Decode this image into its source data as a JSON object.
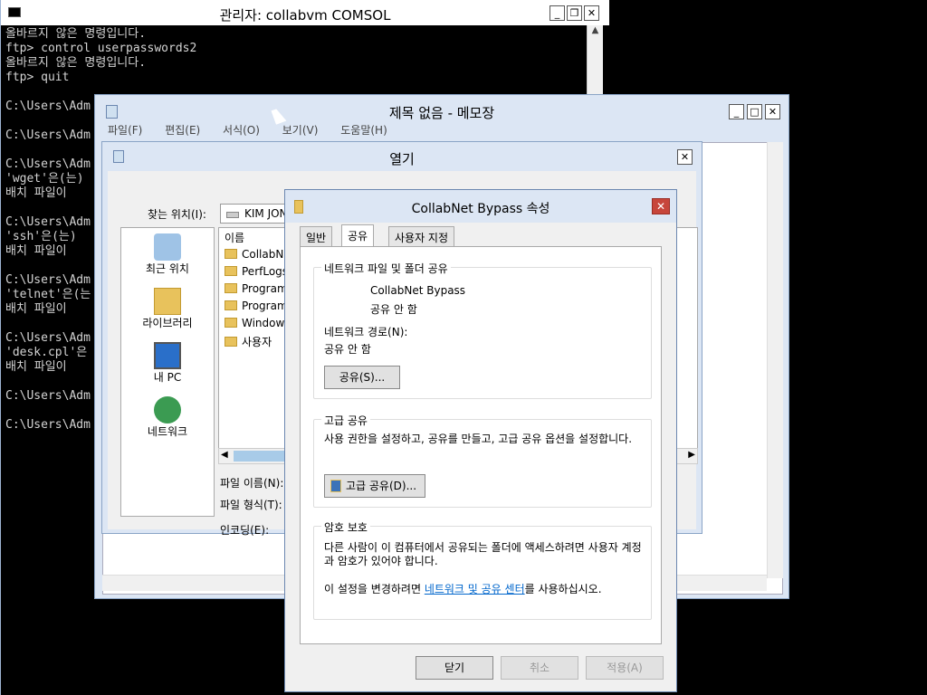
{
  "console": {
    "title": "관리자:  collabvm COMSOL",
    "lines": [
      "올바르지 않은 명령입니다.",
      "ftp> control userpasswords2",
      "올바르지 않은 명령입니다.",
      "ftp> quit",
      "",
      "C:\\Users\\Adm",
      "",
      "C:\\Users\\Adm",
      "",
      "C:\\Users\\Adm",
      "'wget'은(는)",
      "배치 파일이",
      "",
      "C:\\Users\\Adm",
      "'ssh'은(는)",
      "배치 파일이",
      "",
      "C:\\Users\\Adm",
      "'telnet'은(는",
      "배치 파일이",
      "",
      "C:\\Users\\Adm",
      "'desk.cpl'은",
      "배치 파일이",
      "",
      "C:\\Users\\Adm",
      "",
      "C:\\Users\\Adm"
    ]
  },
  "notepad": {
    "title": "제목 없음 - 메모장",
    "menu": [
      "파일(F)",
      "편집(E)",
      "서식(O)",
      "보기(V)",
      "도움말(H)"
    ]
  },
  "open_dialog": {
    "title": "열기",
    "look_in_label": "찾는 위치(I):",
    "look_in_value": "KIM JONG UN (C:)",
    "places": [
      "최근 위치",
      "라이브러리",
      "내 PC",
      "네트워크"
    ],
    "column_name": "이름",
    "files": [
      "CollabNet",
      "PerfLogs",
      "Program F",
      "Program F",
      "Windows",
      "사용자"
    ],
    "filename_label": "파일 이름(N):",
    "filetype_label": "파일 형식(T):",
    "encoding_label": "인코딩(E):"
  },
  "props": {
    "title": "CollabNet Bypass 속성",
    "close": "✕",
    "tabs": [
      "일반",
      "공유",
      "사용자 지정"
    ],
    "net_share_group": "네트워크 파일 및 폴더 공유",
    "share_name": "CollabNet Bypass",
    "share_state": "공유 안 함",
    "net_path_label": "네트워크 경로(N):",
    "net_path_value": "공유 안 함",
    "share_button": "공유(S)...",
    "adv_group": "고급 공유",
    "adv_text": "사용 권한을 설정하고, 공유를 만들고, 고급 공유 옵션을 설정합니다.",
    "adv_button": "고급 공유(D)...",
    "pwd_group": "암호 보호",
    "pwd_text": "다른 사람이 이 컴퓨터에서 공유되는 폴더에 액세스하려면 사용자 계정과 암호가 있어야 합니다.",
    "pwd_change_prefix": "이 설정을 변경하려면 ",
    "pwd_link": "네트워크 및 공유 센터",
    "pwd_change_suffix": "를 사용하십시오.",
    "ok": "닫기",
    "cancel": "취소",
    "apply": "적용(A)"
  }
}
